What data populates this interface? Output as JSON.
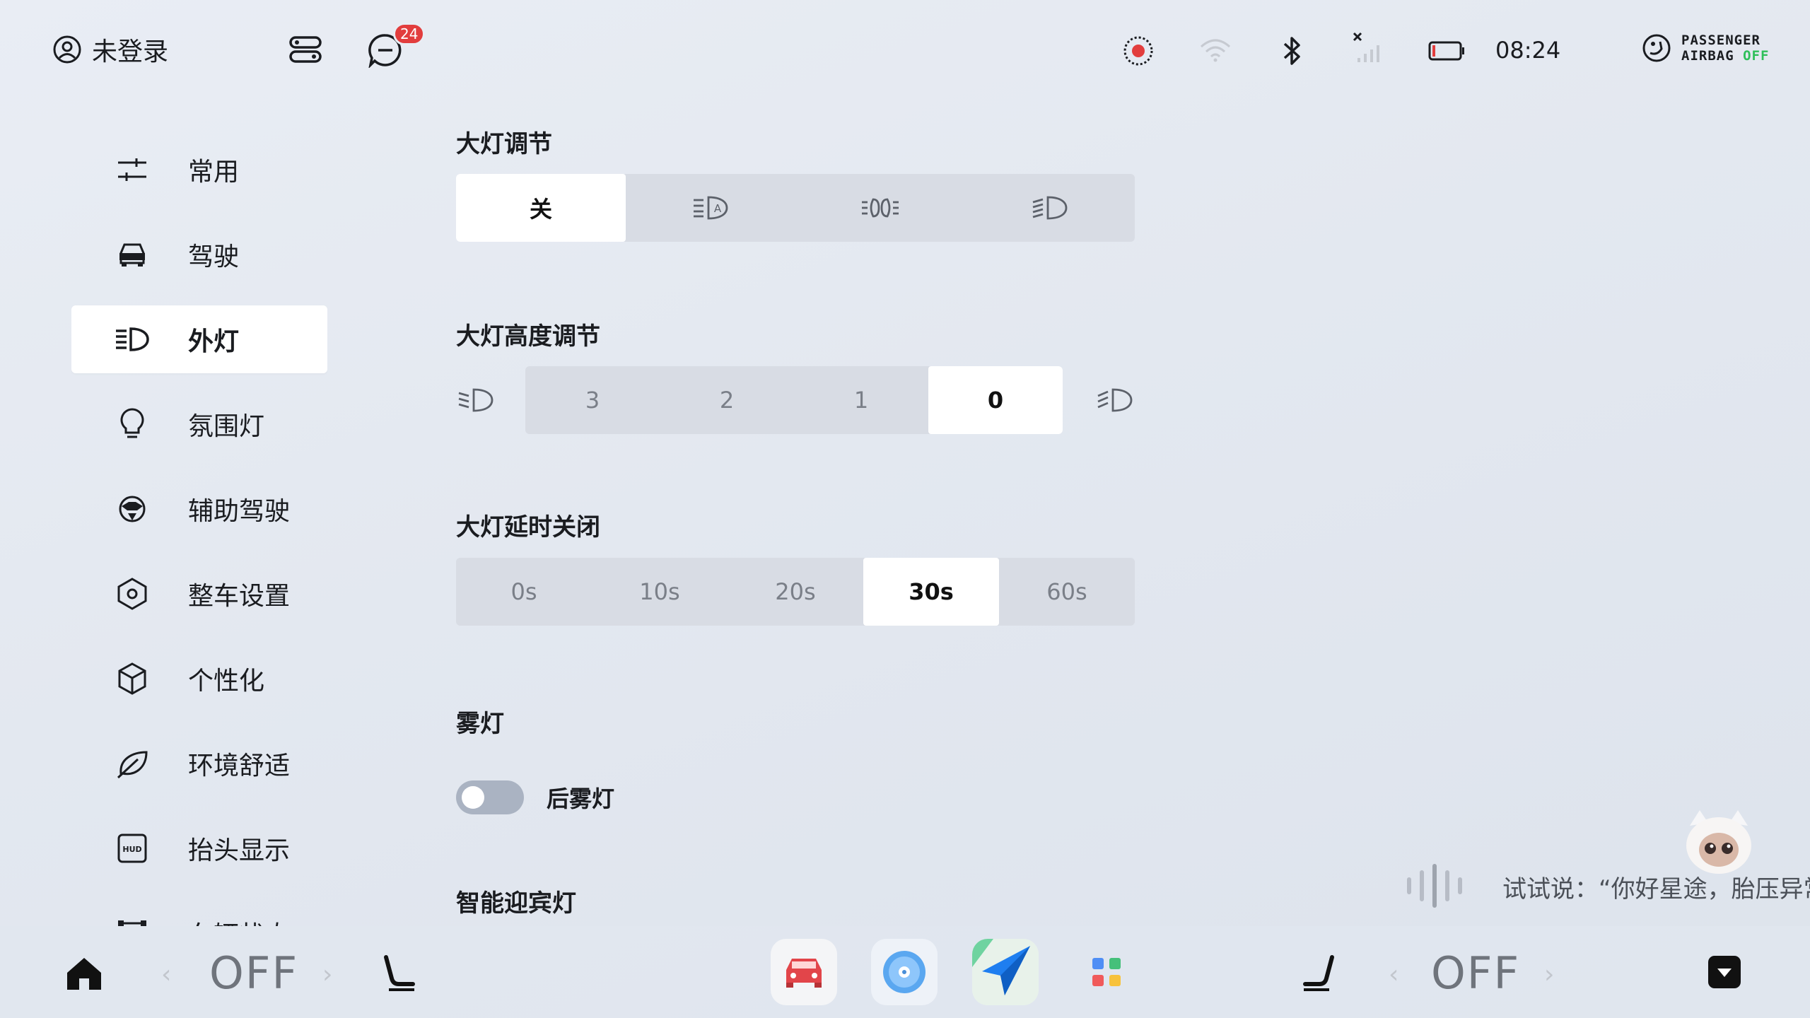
{
  "status_bar": {
    "user_label": "未登录",
    "user_icon": "user-circle-icon",
    "notification_count": "24",
    "time": "08:24",
    "airbag_line1": "PASSENGER",
    "airbag_line2": "AIRBAG",
    "airbag_state": "OFF"
  },
  "sidebar": {
    "items": [
      {
        "label": "常用",
        "icon": "sliders-icon"
      },
      {
        "label": "驾驶",
        "icon": "car-icon"
      },
      {
        "label": "外灯",
        "icon": "headlight-icon",
        "active": true
      },
      {
        "label": "氛围灯",
        "icon": "bulb-icon"
      },
      {
        "label": "辅助驾驶",
        "icon": "steering-wheel-icon"
      },
      {
        "label": "整车设置",
        "icon": "hexagon-gear-icon"
      },
      {
        "label": "个性化",
        "icon": "cube-icon"
      },
      {
        "label": "环境舒适",
        "icon": "leaf-icon"
      },
      {
        "label": "抬头显示",
        "icon": "hud-icon"
      },
      {
        "label": "车辆状态",
        "icon": "vehicle-status-icon"
      }
    ],
    "hud_text": "HUD"
  },
  "headlight": {
    "title": "大灯调节",
    "options": [
      "关",
      "auto-headlight-icon",
      "position-light-icon",
      "low-beam-icon"
    ],
    "selected_label": "关"
  },
  "height": {
    "title": "大灯高度调节",
    "options": [
      "3",
      "2",
      "1",
      "0"
    ],
    "selected": "0"
  },
  "delay": {
    "title": "大灯延时关闭",
    "options": [
      "0s",
      "10s",
      "20s",
      "30s",
      "60s"
    ],
    "selected": "30s"
  },
  "fog": {
    "title": "雾灯",
    "rear_label": "后雾灯",
    "rear_on": false
  },
  "welcome": {
    "title": "智能迎宾灯"
  },
  "voice": {
    "hint": "试试说：“你好星途，胎压异常”"
  },
  "dock": {
    "left_temp": "OFF",
    "right_temp": "OFF"
  },
  "colors": {
    "badge": "#e23d3d",
    "airbag_off": "#2fbf5a",
    "segment_bg": "#d8dce4",
    "selected_bg": "#ffffff"
  }
}
